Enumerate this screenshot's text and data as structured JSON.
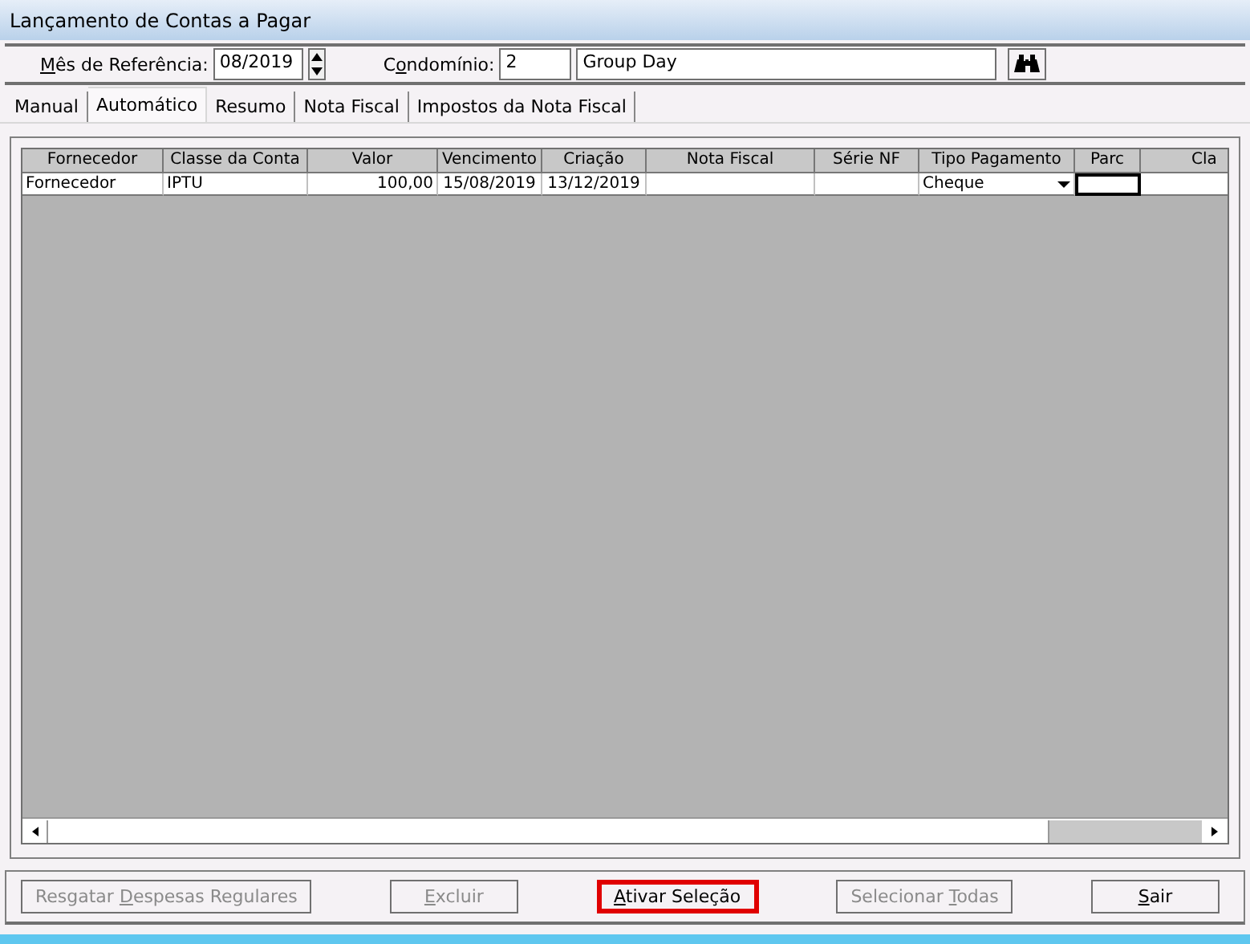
{
  "window": {
    "title": "Lançamento de Contas a Pagar"
  },
  "header": {
    "month": {
      "label": [
        {
          "text": "M",
          "mnemonic": true
        },
        {
          "text": "ês de Referência:",
          "mnemonic": false
        }
      ],
      "value": "08/2019"
    },
    "condo": {
      "label": [
        {
          "text": "C",
          "mnemonic": false
        },
        {
          "text": "o",
          "mnemonic": true
        },
        {
          "text": "ndomínio:",
          "mnemonic": false
        }
      ],
      "code": "2",
      "name": "Group Day"
    }
  },
  "tabs": [
    {
      "label": "Manual",
      "selected": false
    },
    {
      "label": "Automático",
      "selected": true
    },
    {
      "label": "Resumo",
      "selected": false
    },
    {
      "label": "Nota Fiscal",
      "selected": false
    },
    {
      "label": "Impostos da Nota Fiscal",
      "selected": false
    }
  ],
  "table": {
    "columns": [
      {
        "label": "Fornecedor"
      },
      {
        "label": "Classe da Conta"
      },
      {
        "label": "Valor"
      },
      {
        "label": "Vencimento"
      },
      {
        "label": "Criação"
      },
      {
        "label": "Nota Fiscal"
      },
      {
        "label": "Série NF"
      },
      {
        "label": "Tipo Pagamento"
      },
      {
        "label": "Parc"
      },
      {
        "label": "Cla"
      }
    ],
    "rows": [
      {
        "cells": [
          {
            "kind": "text",
            "value": "Fornecedor"
          },
          {
            "kind": "text",
            "value": "IPTU"
          },
          {
            "kind": "text",
            "value": "100,00"
          },
          {
            "kind": "text",
            "value": "15/08/2019"
          },
          {
            "kind": "text",
            "value": "13/12/2019"
          },
          {
            "kind": "text"
          },
          {
            "kind": "text"
          },
          {
            "kind": "dropdown",
            "value": "Cheque"
          },
          {
            "kind": "focused"
          },
          {
            "kind": "text"
          }
        ]
      }
    ]
  },
  "buttons": [
    {
      "parts": [
        {
          "text": "Resgatar ",
          "mnemonic": false
        },
        {
          "text": "D",
          "mnemonic": true
        },
        {
          "text": "espesas Regulares",
          "mnemonic": false
        }
      ],
      "disabled": true,
      "highlighted": false
    },
    {
      "parts": [
        {
          "text": "E",
          "mnemonic": true
        },
        {
          "text": "xcluir",
          "mnemonic": false
        }
      ],
      "disabled": true,
      "highlighted": false
    },
    {
      "parts": [
        {
          "text": "A",
          "mnemonic": true
        },
        {
          "text": "tivar Seleção",
          "mnemonic": false
        }
      ],
      "disabled": false,
      "highlighted": true
    },
    {
      "parts": [
        {
          "text": "Selecionar ",
          "mnemonic": false
        },
        {
          "text": "T",
          "mnemonic": true
        },
        {
          "text": "odas",
          "mnemonic": false
        }
      ],
      "disabled": true,
      "highlighted": false
    },
    {
      "parts": [
        {
          "text": "S",
          "mnemonic": true
        },
        {
          "text": "air",
          "mnemonic": false
        }
      ],
      "disabled": false,
      "highlighted": false
    }
  ]
}
